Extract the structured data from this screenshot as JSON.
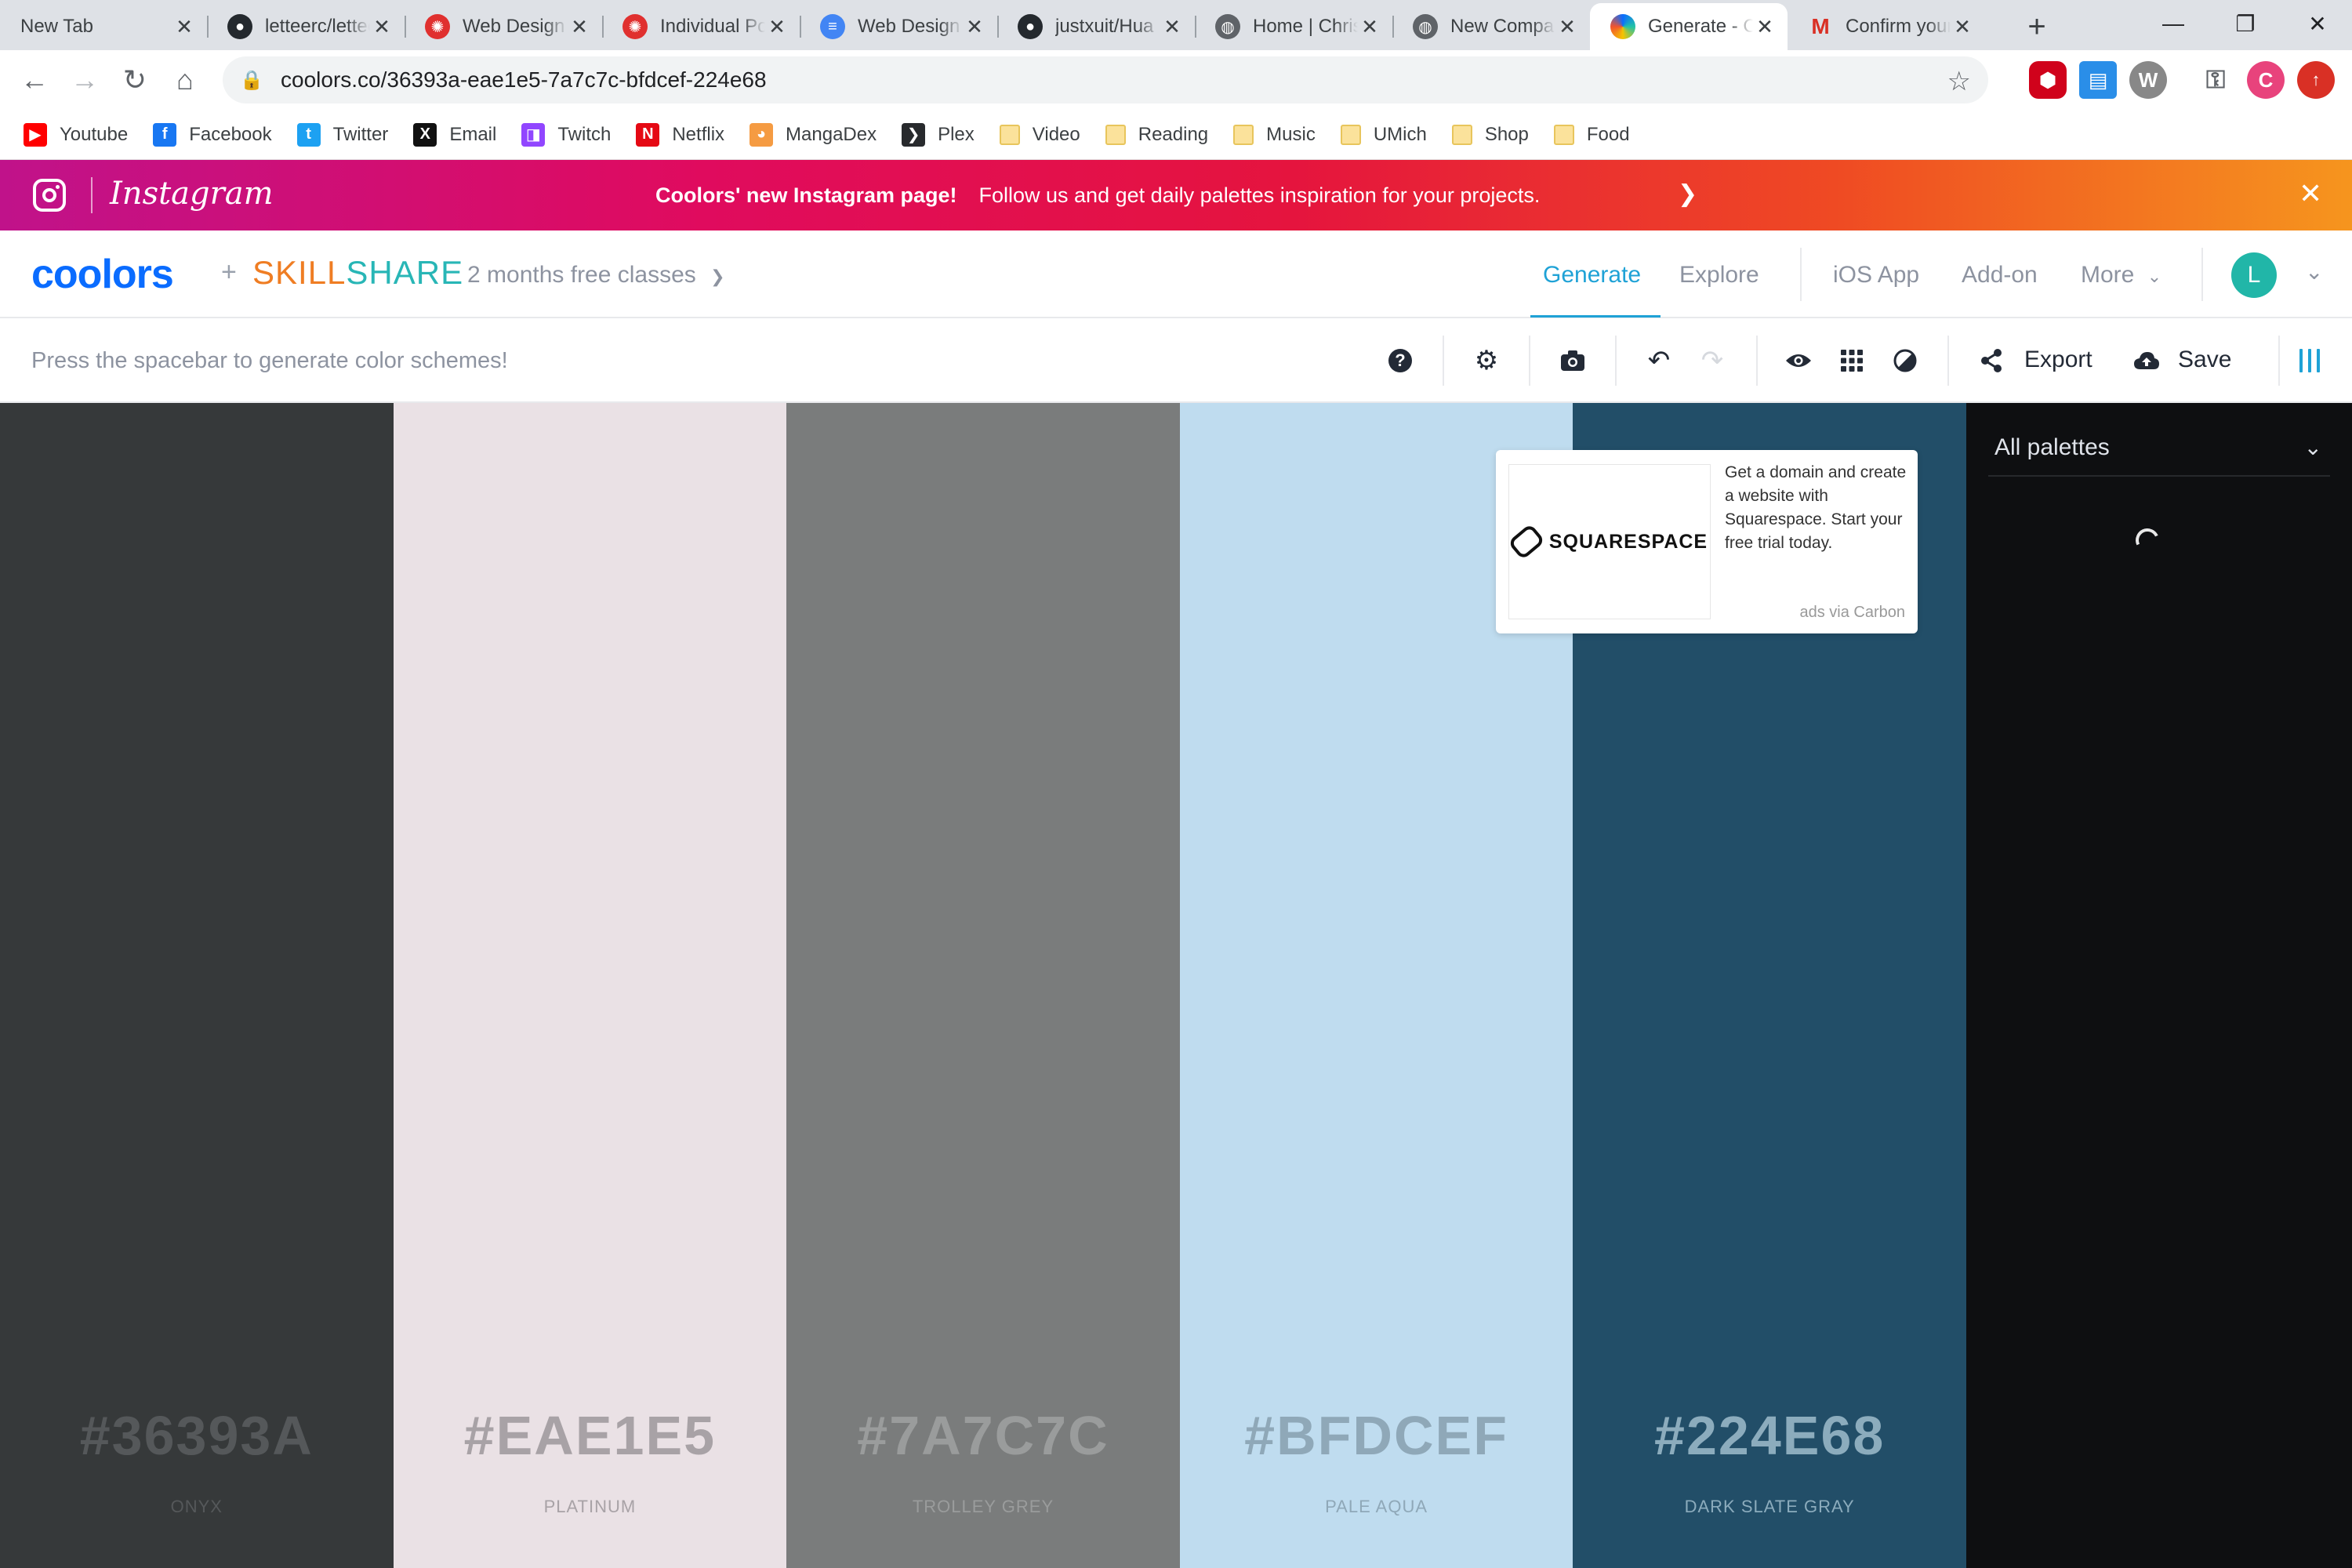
{
  "browser": {
    "tabs": [
      {
        "title": "New Tab",
        "icon": "none",
        "color": "#dee1e6"
      },
      {
        "title": "letteerc/letteerc",
        "icon": "github-icon",
        "color": "#24292e"
      },
      {
        "title": "Web Design",
        "icon": "umich-icon",
        "color": "#e0302f"
      },
      {
        "title": "Individual Portfolio",
        "icon": "umich-icon",
        "color": "#e0302f"
      },
      {
        "title": "Web Design",
        "icon": "google-docs-icon",
        "color": "#4285f4"
      },
      {
        "title": "justxuit/Hua",
        "icon": "github-icon",
        "color": "#24292e"
      },
      {
        "title": "Home | Chris",
        "icon": "globe-icon",
        "color": "#5f6368"
      },
      {
        "title": "New Company",
        "icon": "globe-icon",
        "color": "#5f6368"
      },
      {
        "title": "Generate - Coolors",
        "icon": "coolors-icon",
        "color": "#0a6cff",
        "active": true
      },
      {
        "title": "Confirm your",
        "icon": "gmail-icon",
        "color": "#d93025"
      }
    ],
    "url": "coolors.co/36393a-eae1e5-7a7c7c-bfdcef-224e68",
    "bookmarks": [
      {
        "label": "Youtube",
        "icon": "youtube-icon",
        "color": "#ff0000",
        "glyph": "▶"
      },
      {
        "label": "Facebook",
        "icon": "facebook-icon",
        "color": "#1877f2",
        "glyph": "f"
      },
      {
        "label": "Twitter",
        "icon": "twitter-icon",
        "color": "#1da1f2",
        "glyph": "t"
      },
      {
        "label": "Email",
        "icon": "x-mail-icon",
        "color": "#111111",
        "glyph": "X"
      },
      {
        "label": "Twitch",
        "icon": "twitch-icon",
        "color": "#9146ff",
        "glyph": "◨"
      },
      {
        "label": "Netflix",
        "icon": "netflix-icon",
        "color": "#e50914",
        "glyph": "N"
      },
      {
        "label": "MangaDex",
        "icon": "mangadex-icon",
        "color": "#f59b42",
        "glyph": "◕"
      },
      {
        "label": "Plex",
        "icon": "plex-icon",
        "color": "#282a2d",
        "glyph": "❯"
      },
      {
        "label": "Video",
        "icon": "folder-icon",
        "folder": true
      },
      {
        "label": "Reading",
        "icon": "folder-icon",
        "folder": true
      },
      {
        "label": "Music",
        "icon": "folder-icon",
        "folder": true
      },
      {
        "label": "UMich",
        "icon": "folder-icon",
        "folder": true
      },
      {
        "label": "Shop",
        "icon": "folder-icon",
        "folder": true
      },
      {
        "label": "Food",
        "icon": "folder-icon",
        "folder": true
      }
    ],
    "profile_initial": "C"
  },
  "promo": {
    "brand": "Instagram",
    "headline": "Coolors' new Instagram page!",
    "message": "Follow us and get daily palettes inspiration for your projects."
  },
  "nav": {
    "logo": "coolors",
    "plus": "+",
    "partner": "SKILLSHARE",
    "partner_offer": "2 months free classes",
    "links": {
      "generate": "Generate",
      "explore": "Explore",
      "ios": "iOS App",
      "addon": "Add-on",
      "more": "More"
    },
    "avatar_initial": "L",
    "accent": "#1fa2d6"
  },
  "toolbar": {
    "hint": "Press the spacebar to generate color schemes!",
    "export": "Export",
    "save": "Save"
  },
  "palette": [
    {
      "hex": "#36393A",
      "name": "ONYX",
      "bg": "#36393a",
      "fg": "#55585a"
    },
    {
      "hex": "#EAE1E5",
      "name": "PLATINUM",
      "bg": "#eae1e5",
      "fg": "#a8a2a6"
    },
    {
      "hex": "#7A7C7C",
      "name": "TROLLEY GREY",
      "bg": "#7a7c7c",
      "fg": "#9a9c9c"
    },
    {
      "hex": "#BFDCEF",
      "name": "PALE AQUA",
      "bg": "#bfdcef",
      "fg": "#8fa8b8"
    },
    {
      "hex": "#224E68",
      "name": "DARK SLATE GRAY",
      "bg": "#224e68",
      "fg": "#8cacbd"
    }
  ],
  "ad": {
    "brand": "SQUARESPACE",
    "text": "Get a domain and create a website with Squarespace. Start your free trial today.",
    "credit": "ads via Carbon"
  },
  "sidebar": {
    "title": "All palettes"
  }
}
